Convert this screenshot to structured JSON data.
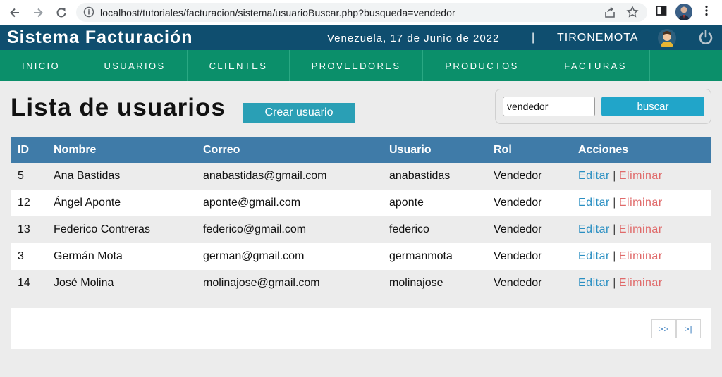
{
  "browser": {
    "url": "localhost/tutoriales/facturacion/sistema/usuarioBuscar.php?busqueda=vendedor"
  },
  "header": {
    "title": "Sistema Facturación",
    "date": "Venezuela, 17 de Junio de 2022",
    "separator": "|",
    "user": "TIRONEMOTA"
  },
  "menu": {
    "items": [
      {
        "label": "INICIO"
      },
      {
        "label": "USUARIOS"
      },
      {
        "label": "CLIENTES"
      },
      {
        "label": "PROVEEDORES"
      },
      {
        "label": "PRODUCTOS"
      },
      {
        "label": "FACTURAS"
      }
    ]
  },
  "page": {
    "title": "Lista de usuarios",
    "create_label": "Crear usuario"
  },
  "search": {
    "value": "vendedor",
    "button_label": "buscar"
  },
  "table": {
    "headers": [
      "ID",
      "Nombre",
      "Correo",
      "Usuario",
      "Rol",
      "Acciones"
    ],
    "edit_label": "Editar",
    "delete_label": "Eliminar",
    "action_sep": "|",
    "rows": [
      {
        "id": "5",
        "nombre": "Ana Bastidas",
        "correo": "anabastidas@gmail.com",
        "usuario": "anabastidas",
        "rol": "Vendedor"
      },
      {
        "id": "12",
        "nombre": "Ángel Aponte",
        "correo": "aponte@gmail.com",
        "usuario": "aponte",
        "rol": "Vendedor"
      },
      {
        "id": "13",
        "nombre": "Federico Contreras",
        "correo": "federico@gmail.com",
        "usuario": "federico",
        "rol": "Vendedor"
      },
      {
        "id": "3",
        "nombre": "Germán Mota",
        "correo": "german@gmail.com",
        "usuario": "germanmota",
        "rol": "Vendedor"
      },
      {
        "id": "14",
        "nombre": "José Molina",
        "correo": "molinajose@gmail.com",
        "usuario": "molinajose",
        "rol": "Vendedor"
      }
    ]
  },
  "pagination": {
    "next_label": ">>",
    "last_label": ">|"
  },
  "colors": {
    "header_bg": "#0f4e6f",
    "menu_bg": "#0b8f6a",
    "table_header_bg": "#3f7ba8",
    "create_btn": "#2a9fb5",
    "search_btn": "#21a5c9",
    "edit_link": "#2a8fc2",
    "delete_link": "#e06a6a"
  },
  "icons": [
    "back-icon",
    "forward-icon",
    "reload-icon",
    "info-icon",
    "share-icon",
    "star-icon",
    "sidepanel-icon",
    "profile-avatar",
    "kebab-menu-icon",
    "user-avatar-icon",
    "power-icon"
  ]
}
